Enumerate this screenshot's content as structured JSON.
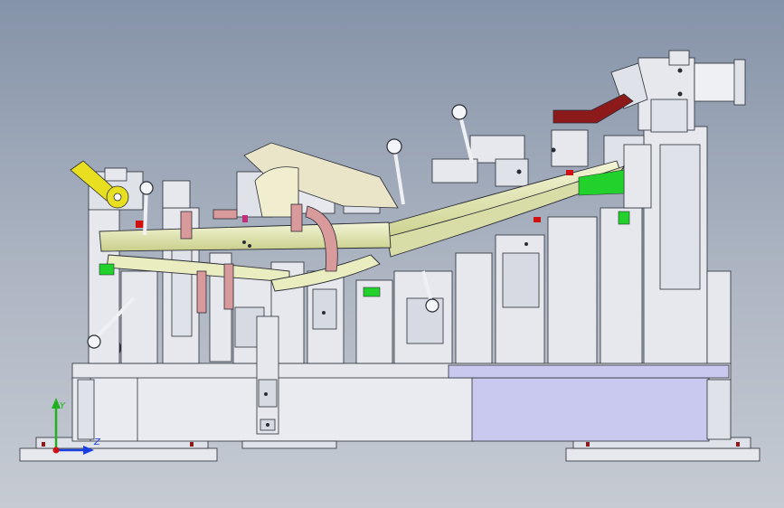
{
  "viewport": {
    "background_top": "#8593a8",
    "background_bottom": "#c6cbd3"
  },
  "colors": {
    "frame": "#e6e8ee",
    "frame_dark": "#b9bec9",
    "outline": "#2a2d35",
    "base_panel": "#c9c8ee",
    "rail_part": "#e9edc0",
    "rail_part_dark": "#c9cf8a",
    "clamp_red": "#8c1a1a",
    "accent_green": "#22d12b",
    "accent_pink": "#d89a9a",
    "accent_yellow": "#e8df20",
    "accent_magenta": "#c0307a"
  },
  "triad": {
    "y_label": "Y",
    "z_label": "Z",
    "y_color": "#20b020",
    "z_color": "#1a3fe0",
    "origin_color": "#d01010"
  }
}
